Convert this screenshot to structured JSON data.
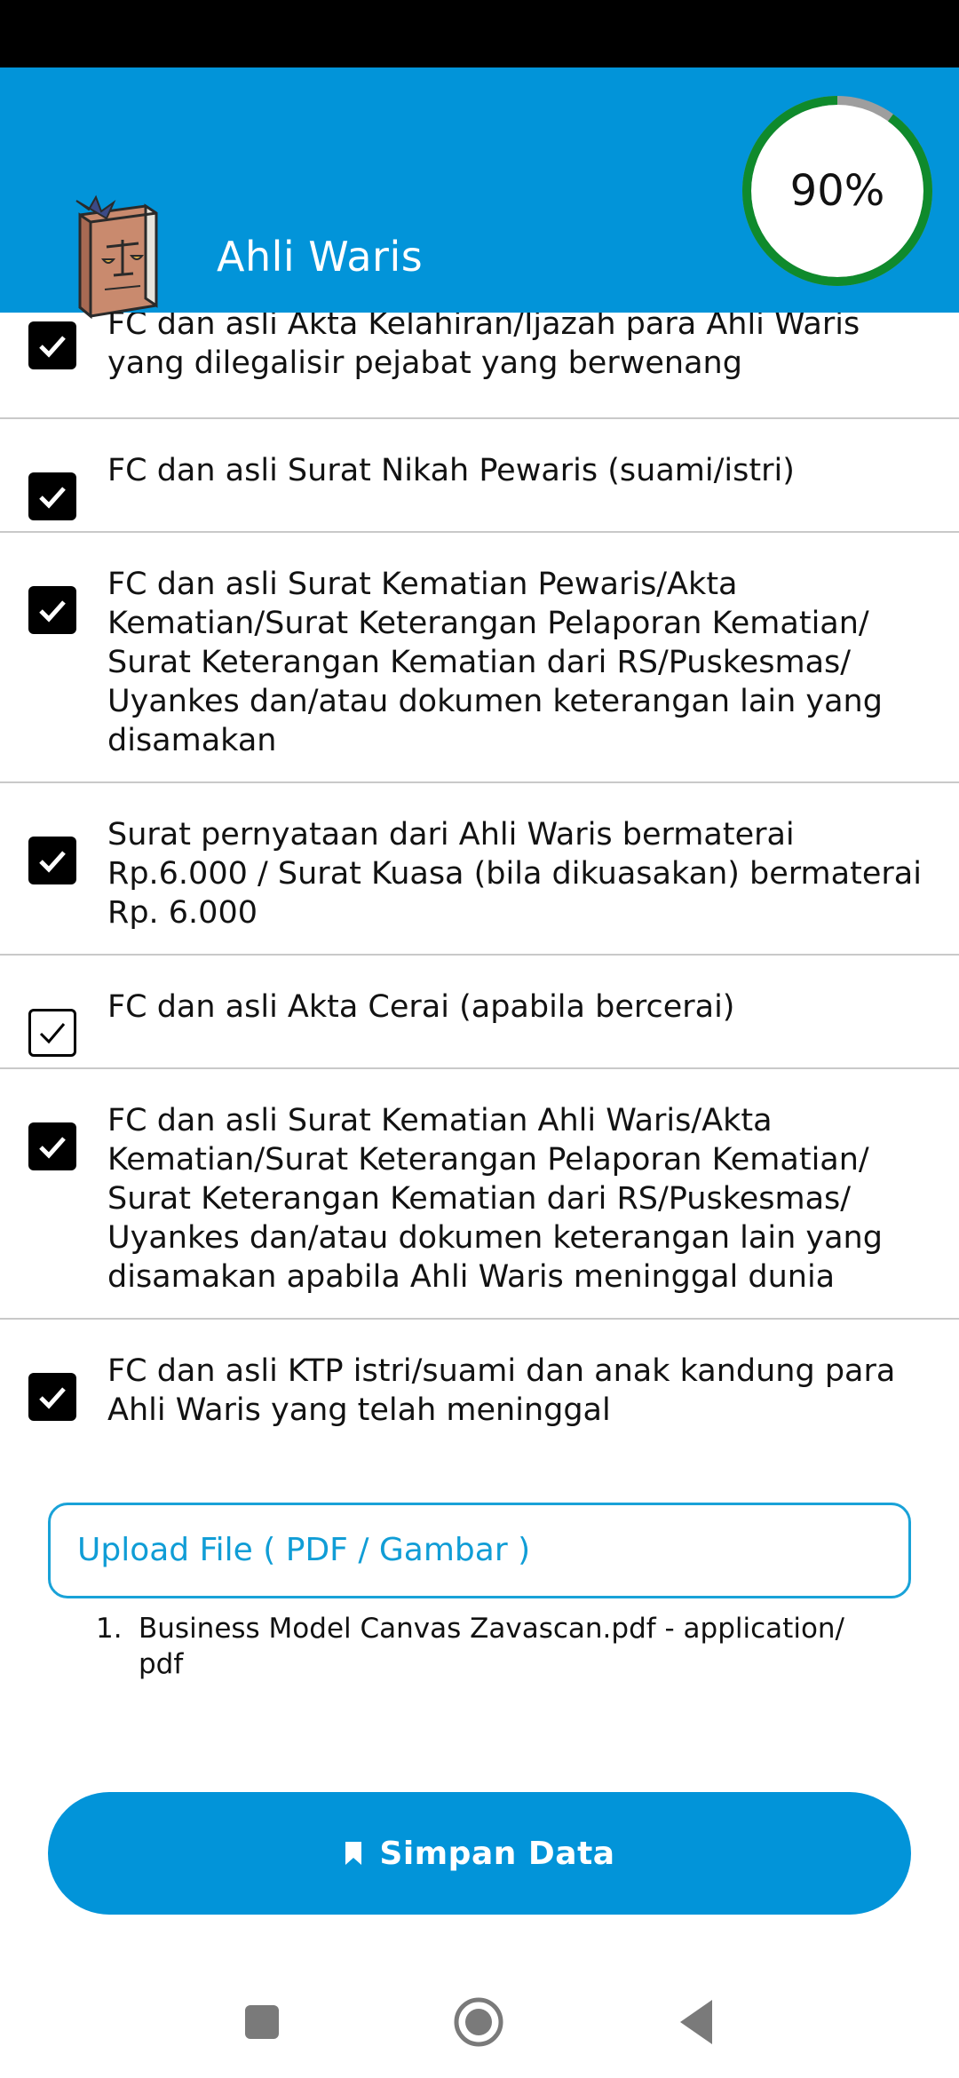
{
  "header": {
    "title": "Ahli Waris",
    "progress_label": "90%",
    "progress_value": 0.9,
    "logo_icon": "law-book-icon"
  },
  "checklist": {
    "items": [
      {
        "label": "FC dan asli Akta Kelahiran/Ijazah para Ahli Waris yang dilegalisir pejabat yang berwenang",
        "checked": true
      },
      {
        "label": "FC dan asli Surat Nikah Pewaris (suami/istri)",
        "checked": true
      },
      {
        "label": "FC dan asli Surat Kematian Pewaris/Akta Kematian/Surat Keterangan Pelaporan Kematian/ Surat Keterangan Kematian dari RS/Puskesmas/ Uyankes dan/atau dokumen keterangan lain yang disamakan",
        "checked": true
      },
      {
        "label": "Surat pernyataan dari Ahli Waris bermaterai Rp.6.000 / Surat Kuasa (bila dikuasakan) bermaterai Rp. 6.000",
        "checked": true
      },
      {
        "label": "FC dan asli Akta Cerai (apabila bercerai)",
        "checked": true
      },
      {
        "label": "FC dan asli Surat Kematian Ahli Waris/Akta Kematian/Surat Keterangan Pelaporan Kematian/ Surat Keterangan Kematian dari RS/Puskesmas/ Uyankes dan/atau dokumen keterangan lain yang disamakan apabila Ahli Waris meninggal dunia",
        "checked": true
      },
      {
        "label": "FC dan asli KTP istri/suami dan anak kandung para Ahli Waris yang telah meninggal",
        "checked": true
      }
    ]
  },
  "upload": {
    "label": "Upload File ( PDF / Gambar )",
    "files": [
      {
        "number": "1.",
        "name": "Business Model Canvas Zavascan.pdf - application/ pdf"
      }
    ]
  },
  "save_button": {
    "label": "Simpan Data",
    "icon": "bookmark-icon"
  },
  "colors": {
    "primary": "#0294d9",
    "progress": "#0f8a2c",
    "progress_track": "#9e9e9e",
    "upload_border": "#19a2d8"
  },
  "nav": {
    "icons": [
      "recents-icon",
      "home-icon",
      "back-icon"
    ]
  }
}
